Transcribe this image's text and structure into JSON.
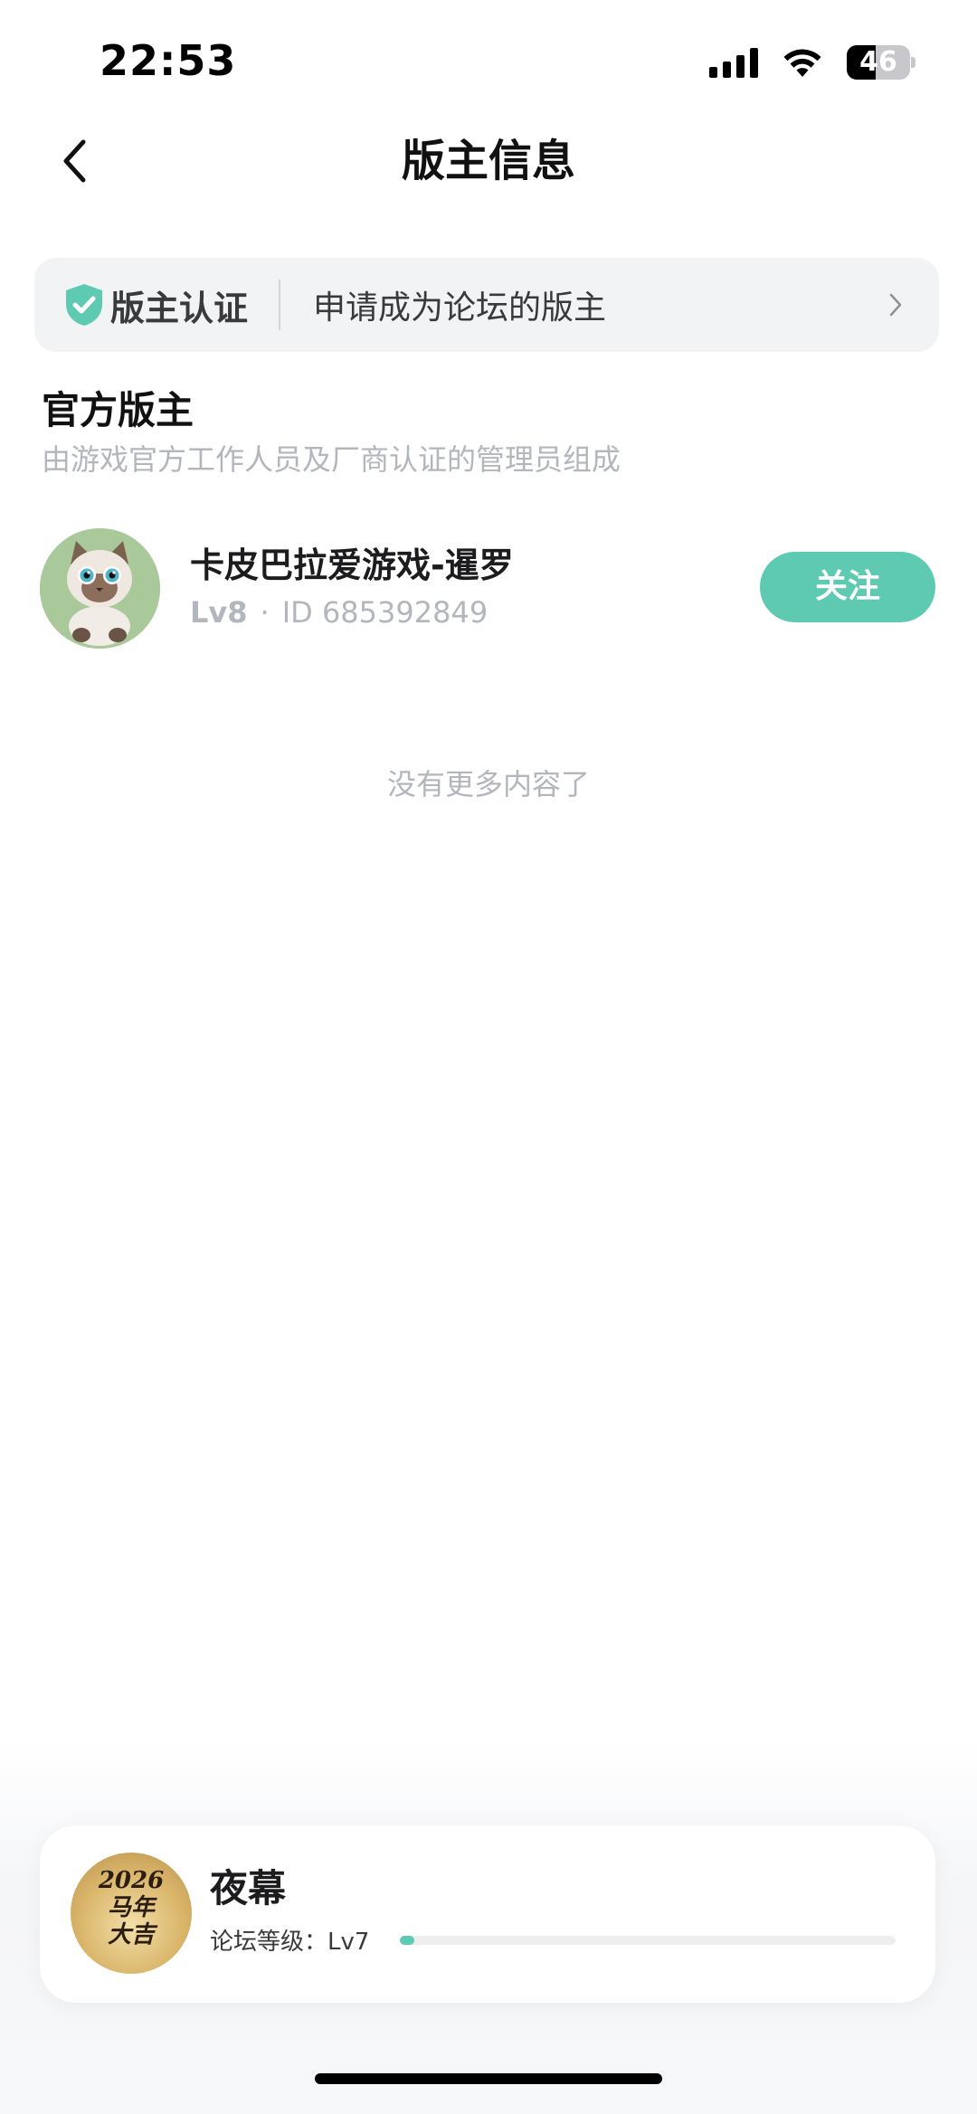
{
  "status_bar": {
    "time": "22:53",
    "battery": "46",
    "battery_level": 0.46,
    "icons": [
      "signal-icon",
      "wifi-icon",
      "battery-icon"
    ]
  },
  "nav": {
    "title": "版主信息",
    "back_icon": "chevron-left-icon"
  },
  "cert_banner": {
    "label": "版主认证",
    "description": "申请成为论坛的版主",
    "shield_icon": "shield-check-icon",
    "chevron_icon": "chevron-right-icon"
  },
  "section": {
    "title": "官方版主",
    "subtitle": "由游戏官方工作人员及厂商认证的管理员组成"
  },
  "moderator": {
    "name": "卡皮巴拉爱游戏-暹罗",
    "level": "Lv8",
    "separator": "·",
    "id_text": "ID 685392849",
    "follow_label": "关注"
  },
  "list_end": "没有更多内容了",
  "user_card": {
    "name": "夜幕",
    "level_label": "论坛等级：Lv7",
    "level_progress": 0.03,
    "avatar_text_lines": [
      "2026",
      "马年",
      "大吉"
    ]
  },
  "colors": {
    "accent": "#5ecab2",
    "muted_text": "#b3b6bc",
    "banner_bg": "#f2f3f5"
  }
}
